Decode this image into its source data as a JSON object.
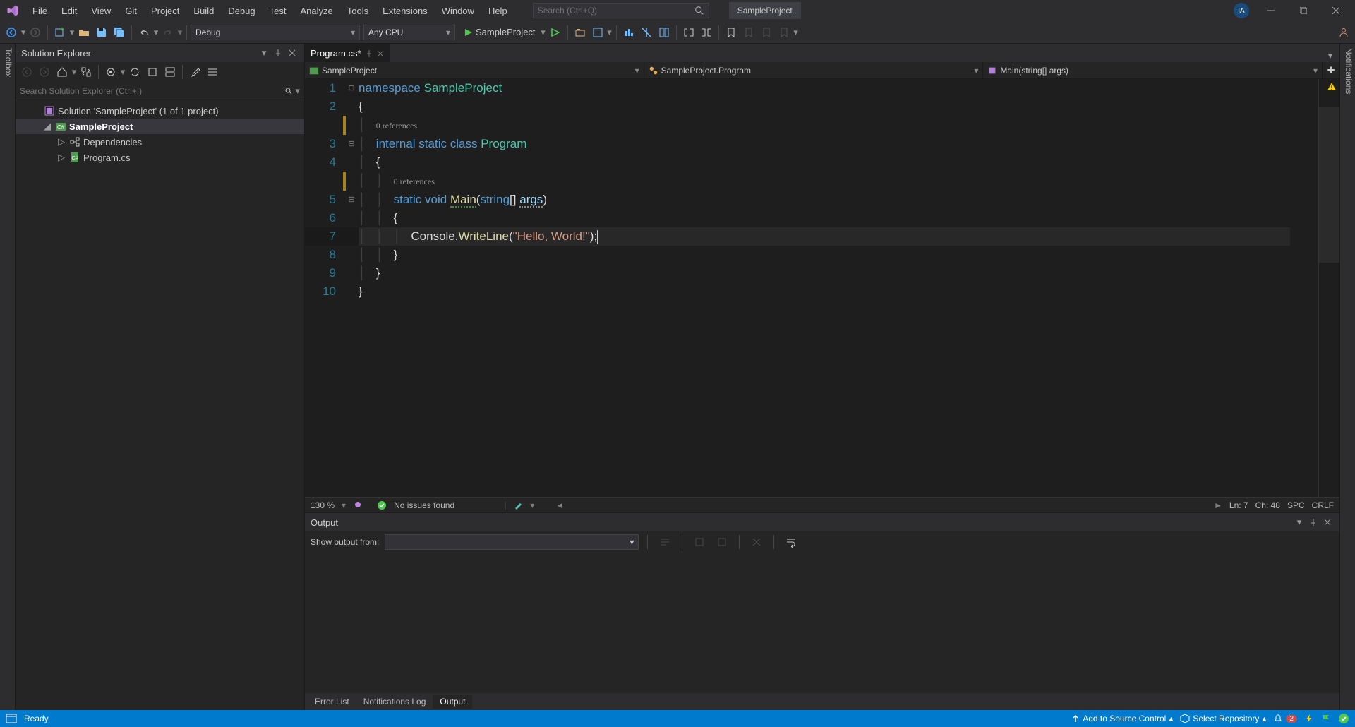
{
  "titlebar": {
    "menu": [
      "File",
      "Edit",
      "View",
      "Git",
      "Project",
      "Build",
      "Debug",
      "Test",
      "Analyze",
      "Tools",
      "Extensions",
      "Window",
      "Help"
    ],
    "search_placeholder": "Search (Ctrl+Q)",
    "project_button": "SampleProject",
    "avatar_initials": "IA"
  },
  "toolbar": {
    "configuration": "Debug",
    "platform": "Any CPU",
    "start_label": "SampleProject"
  },
  "left_tab": "Toolbox",
  "right_tab": "Notifications",
  "solution_explorer": {
    "title": "Solution Explorer",
    "search_placeholder": "Search Solution Explorer (Ctrl+;)",
    "root": "Solution 'SampleProject' (1 of 1 project)",
    "project": "SampleProject",
    "dependencies": "Dependencies",
    "file": "Program.cs"
  },
  "tab": {
    "name": "Program.cs*"
  },
  "navbar": {
    "project": "SampleProject",
    "class": "SampleProject.Program",
    "method": "Main(string[] args)"
  },
  "code": {
    "codelens1": "0 references",
    "codelens2": "0 references",
    "lines": {
      "l1": {
        "n": "1"
      },
      "l2": {
        "n": "2"
      },
      "l3": {
        "n": "3"
      },
      "l4": {
        "n": "4"
      },
      "l5": {
        "n": "5"
      },
      "l6": {
        "n": "6"
      },
      "l7": {
        "n": "7"
      },
      "l8": {
        "n": "8"
      },
      "l9": {
        "n": "9"
      },
      "l10": {
        "n": "10"
      }
    },
    "tok": {
      "namespace": "namespace",
      "proj": "SampleProject",
      "lbrace": "{",
      "rbrace": "}",
      "internal": "internal",
      "static": "static",
      "class": "class",
      "Program": "Program",
      "void": "void",
      "Main": "Main",
      "lparen": "(",
      "string": "string",
      "brackets": "[]",
      "args": "args",
      "rparen": ")",
      "Console": "Console",
      "dot": ".",
      "WriteLine": "WriteLine",
      "s1": "\"Hello, World!\"",
      "semi": ";"
    }
  },
  "editor_status": {
    "zoom": "130 %",
    "issues": "No issues found",
    "ln": "Ln: 7",
    "ch": "Ch: 48",
    "spc": "SPC",
    "crlf": "CRLF"
  },
  "output": {
    "title": "Output",
    "show_label": "Show output from:"
  },
  "bottom_tabs": [
    "Error List",
    "Notifications Log",
    "Output"
  ],
  "statusbar": {
    "ready": "Ready",
    "add_source": "Add to Source Control",
    "select_repo": "Select Repository",
    "bell_count": "2"
  }
}
